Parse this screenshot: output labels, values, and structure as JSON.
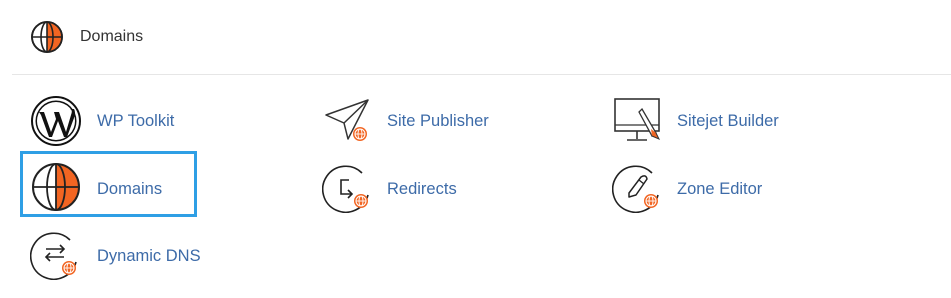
{
  "header": {
    "title": "Domains",
    "icon": "globe-icon"
  },
  "items": [
    {
      "label": "WP Toolkit",
      "icon": "wordpress-icon"
    },
    {
      "label": "Site Publisher",
      "icon": "paper-plane-icon"
    },
    {
      "label": "Sitejet Builder",
      "icon": "monitor-pen-icon"
    },
    {
      "label": "Domains",
      "icon": "globe-icon"
    },
    {
      "label": "Redirects",
      "icon": "redirect-icon"
    },
    {
      "label": "Zone Editor",
      "icon": "zone-editor-icon"
    },
    {
      "label": "Dynamic DNS",
      "icon": "dynamic-dns-icon"
    }
  ],
  "colors": {
    "accent_orange": "#f26522",
    "link_blue": "#3d6ba8",
    "highlight_blue": "#2f9fe5"
  }
}
